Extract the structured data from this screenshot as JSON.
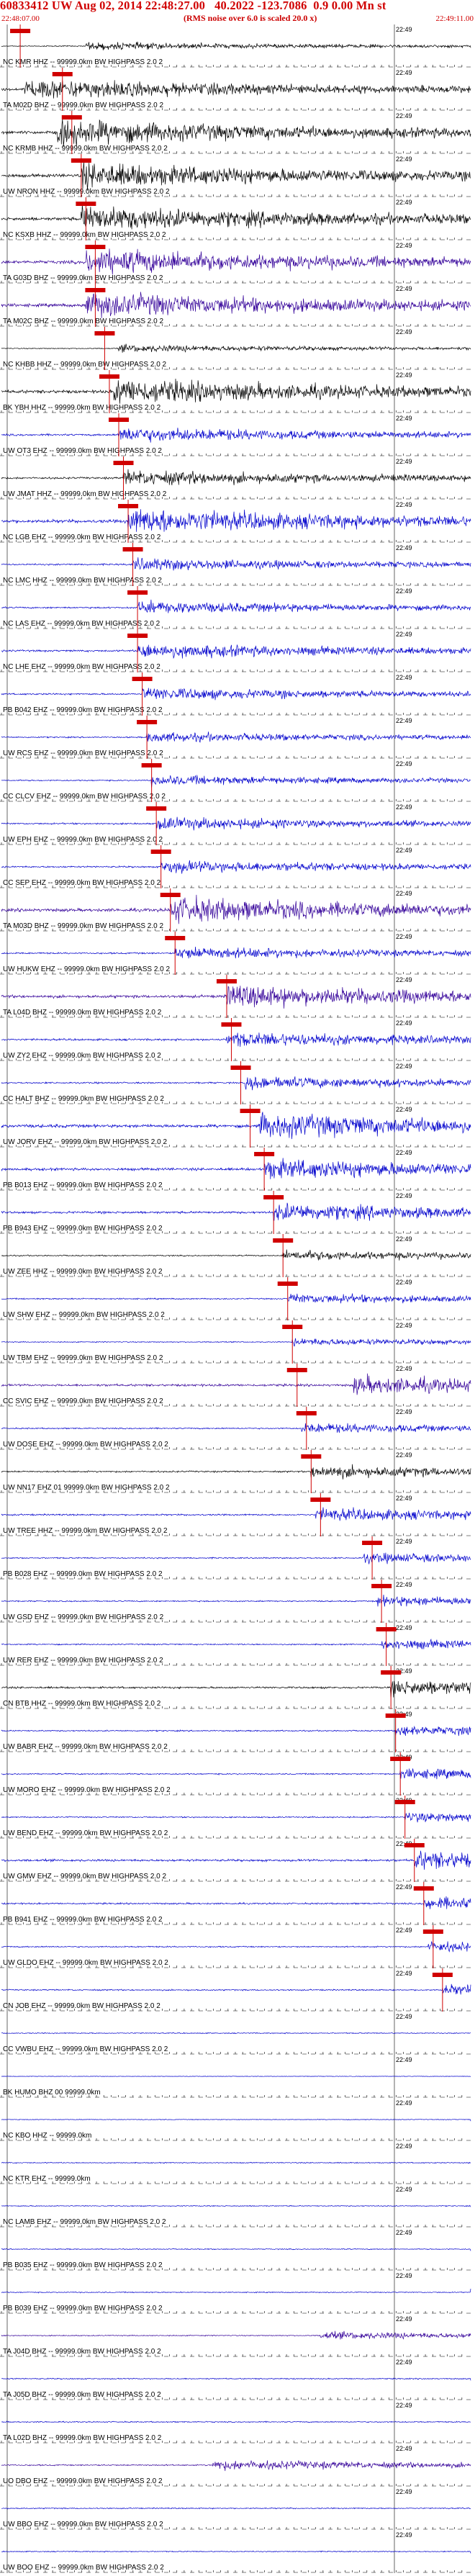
{
  "header": {
    "title": "60833412 UW Aug 02, 2014 22:48:27.00   40.2022 -123.7086  0.9 0.00 Mn st",
    "start_time": "22:48:07.00",
    "end_time": "22:49:11.00",
    "subtitle": "(RMS noise over 6.0 is scaled 20.0 x)"
  },
  "chart_data": {
    "type": "line",
    "title": "60833412 UW Aug 02, 2014 22:48:27.00   40.2022 -123.7086  0.9 0.00 Mn st",
    "time_axis": {
      "start": "22:48:07.00",
      "end": "22:49:11.00",
      "tick_label": "22:49"
    },
    "colors": {
      "background": "#ffffff",
      "pick": "#d00000",
      "black": "#000000",
      "blue": "#0000cc",
      "purple": "#330099"
    },
    "traces": [
      {
        "label": "NC KMR HHZ -- 99999.0km BW HIGHPASS  2.0  2",
        "color": "black",
        "amp": 0.3,
        "onset": 0.18,
        "pick": 0.04
      },
      {
        "label": "TA M02D BHZ -- 99999.0km BW HIGHPASS  2.0  2",
        "color": "black",
        "amp": 0.8,
        "onset": 0.05,
        "pick": 0.13
      },
      {
        "label": "NC KRMB HHZ -- 99999.0km BW HIGHPASS  2.0  2",
        "color": "black",
        "amp": 1.0,
        "onset": 0.12,
        "pick": 0.15
      },
      {
        "label": "UW NRON HHZ -- 99999.0km BW HIGHPASS  2.0  2",
        "color": "black",
        "amp": 1.0,
        "onset": 0.17,
        "pick": 0.17
      },
      {
        "label": "NC KSXB HHZ -- 99999.0km BW HIGHPASS  2.0  2",
        "color": "black",
        "amp": 1.0,
        "onset": 0.17,
        "pick": 0.18
      },
      {
        "label": "TA G03D BHZ -- 99999.0km BW HIGHPASS  2.0  2",
        "color": "purple",
        "amp": 1.0,
        "onset": 0.18,
        "pick": 0.2
      },
      {
        "label": "TA M02C BHZ -- 99999.0km BW HIGHPASS  2.0  2",
        "color": "purple",
        "amp": 1.0,
        "onset": 0.18,
        "pick": 0.2
      },
      {
        "label": "NC KHBB HHZ -- 99999.0km BW HIGHPASS  2.0  2",
        "color": "black",
        "amp": 0.3,
        "onset": 0.25,
        "pick": 0.22
      },
      {
        "label": "BK YBH HHZ -- 99999.0km BW HIGHPASS  2.0  2",
        "color": "black",
        "amp": 1.0,
        "onset": 0.24,
        "pick": 0.23
      },
      {
        "label": "UW OT3 EHZ -- 99999.0km BW HIGHPASS  2.0  2",
        "color": "blue",
        "amp": 0.6,
        "onset": 0.25,
        "pick": 0.25
      },
      {
        "label": "UW JMAT HHZ -- 99999.0km BW HIGHPASS  2.0  2",
        "color": "black",
        "amp": 0.6,
        "onset": 0.26,
        "pick": 0.26
      },
      {
        "label": "NC LGB EHZ -- 99999.0km BW HIGHPASS  2.0  2",
        "color": "blue",
        "amp": 1.0,
        "onset": 0.27,
        "pick": 0.27
      },
      {
        "label": "NC LMC HHZ -- 99999.0km BW HIGHPASS  2.0  2",
        "color": "blue",
        "amp": 0.5,
        "onset": 0.28,
        "pick": 0.28
      },
      {
        "label": "NC LAS EHZ -- 99999.0km BW HIGHPASS  2.0  2",
        "color": "blue",
        "amp": 0.5,
        "onset": 0.29,
        "pick": 0.29
      },
      {
        "label": "NC LHE EHZ -- 99999.0km BW HIGHPASS  2.0  2",
        "color": "blue",
        "amp": 0.6,
        "onset": 0.29,
        "pick": 0.29
      },
      {
        "label": "PB B042 EHZ -- 99999.0km BW HIGHPASS  2.0  2",
        "color": "blue",
        "amp": 0.5,
        "onset": 0.3,
        "pick": 0.3
      },
      {
        "label": "UW RCS EHZ -- 99999.0km BW HIGHPASS  2.0  2",
        "color": "blue",
        "amp": 0.4,
        "onset": 0.31,
        "pick": 0.31
      },
      {
        "label": "CC CLCV EHZ -- 99999.0km BW HIGHPASS  2.0  2",
        "color": "blue",
        "amp": 0.4,
        "onset": 0.32,
        "pick": 0.32
      },
      {
        "label": "UW EPH EHZ -- 99999.0km BW HIGHPASS  2.0  2",
        "color": "blue",
        "amp": 0.5,
        "onset": 0.33,
        "pick": 0.33
      },
      {
        "label": "CC SEP EHZ -- 99999.0km BW HIGHPASS  2.0  2",
        "color": "blue",
        "amp": 0.5,
        "onset": 0.34,
        "pick": 0.34
      },
      {
        "label": "TA M03D BHZ -- 99999.0km BW HIGHPASS  2.0  2",
        "color": "purple",
        "amp": 1.0,
        "onset": 0.36,
        "pick": 0.36
      },
      {
        "label": "UW HUKW EHZ -- 99999.0km BW HIGHPASS  2.0  2",
        "color": "blue",
        "amp": 0.5,
        "onset": 0.37,
        "pick": 0.37
      },
      {
        "label": "TA L04D BHZ -- 99999.0km BW HIGHPASS  2.0  2",
        "color": "purple",
        "amp": 0.9,
        "onset": 0.48,
        "pick": 0.48
      },
      {
        "label": "UW ZY2 EHZ -- 99999.0km BW HIGHPASS  2.0  2",
        "color": "blue",
        "amp": 0.6,
        "onset": 0.48,
        "pick": 0.49
      },
      {
        "label": "CC HALT BHZ -- 99999.0km BW HIGHPASS  2.0  2",
        "color": "blue",
        "amp": 0.5,
        "onset": 0.52,
        "pick": 0.51
      },
      {
        "label": "UW JORV EHZ -- 99999.0km BW HIGHPASS  2.0  2",
        "color": "blue",
        "amp": 1.0,
        "onset": 0.55,
        "pick": 0.53
      },
      {
        "label": "PB B013 EHZ -- 99999.0km BW HIGHPASS  2.0  2",
        "color": "blue",
        "amp": 0.8,
        "onset": 0.56,
        "pick": 0.56
      },
      {
        "label": "PB B943 EHZ -- 99999.0km BW HIGHPASS  2.0  2",
        "color": "blue",
        "amp": 0.7,
        "onset": 0.58,
        "pick": 0.58
      },
      {
        "label": "UW ZEE HHZ -- 99999.0km BW HIGHPASS  2.0  2",
        "color": "black",
        "amp": 0.4,
        "onset": 0.6,
        "pick": 0.6
      },
      {
        "label": "UW SHW EHZ -- 99999.0km BW HIGHPASS  2.0  2",
        "color": "blue",
        "amp": 0.4,
        "onset": 0.61,
        "pick": 0.61
      },
      {
        "label": "UW TBM EHZ -- 99999.0km BW HIGHPASS  2.0  2",
        "color": "blue",
        "amp": 0.3,
        "onset": 0.62,
        "pick": 0.62
      },
      {
        "label": "CC SVIC EHZ -- 99999.0km BW HIGHPASS  2.0  2",
        "color": "purple",
        "amp": 0.7,
        "onset": 0.75,
        "pick": 0.63
      },
      {
        "label": "UW DOSE EHZ -- 99999.0km BW HIGHPASS  2.0  2",
        "color": "blue",
        "amp": 0.4,
        "onset": 0.64,
        "pick": 0.65
      },
      {
        "label": "UW NN17 EHZ 01 99999.0km BW HIGHPASS  2.0  2",
        "color": "black",
        "amp": 0.5,
        "onset": 0.66,
        "pick": 0.66
      },
      {
        "label": "UW TREE HHZ -- 99999.0km BW HIGHPASS  2.0  2",
        "color": "blue",
        "amp": 0.5,
        "onset": 0.67,
        "pick": 0.68
      },
      {
        "label": "PB B028 EHZ -- 99999.0km BW HIGHPASS  2.0  2",
        "color": "blue",
        "amp": 0.4,
        "onset": 0.77,
        "pick": 0.79
      },
      {
        "label": "UW GSD EHZ -- 99999.0km BW HIGHPASS  2.0  2",
        "color": "blue",
        "amp": 0.4,
        "onset": 0.8,
        "pick": 0.81
      },
      {
        "label": "UW RER EHZ -- 99999.0km BW HIGHPASS  2.0  2",
        "color": "blue",
        "amp": 0.4,
        "onset": 0.81,
        "pick": 0.82
      },
      {
        "label": "CN BTB HHZ -- 99999.0km BW HIGHPASS  2.0  2",
        "color": "black",
        "amp": 0.6,
        "onset": 0.83,
        "pick": 0.83
      },
      {
        "label": "UW BABR EHZ -- 99999.0km BW HIGHPASS  2.0  2",
        "color": "blue",
        "amp": 0.4,
        "onset": 0.84,
        "pick": 0.84
      },
      {
        "label": "UW MORO EHZ -- 99999.0km BW HIGHPASS  2.0  2",
        "color": "blue",
        "amp": 0.4,
        "onset": 0.85,
        "pick": 0.85
      },
      {
        "label": "UW BEND EHZ -- 99999.0km BW HIGHPASS  2.0  2",
        "color": "blue",
        "amp": 0.4,
        "onset": 0.86,
        "pick": 0.86
      },
      {
        "label": "UW GMW EHZ -- 99999.0km BW HIGHPASS  2.0  2",
        "color": "blue",
        "amp": 0.7,
        "onset": 0.88,
        "pick": 0.88
      },
      {
        "label": "PB B941 EHZ -- 99999.0km BW HIGHPASS  2.0  2",
        "color": "blue",
        "amp": 0.5,
        "onset": 0.9,
        "pick": 0.9
      },
      {
        "label": "UW GLDO EHZ -- 99999.0km BW HIGHPASS  2.0  2",
        "color": "blue",
        "amp": 0.4,
        "onset": 0.91,
        "pick": 0.92
      },
      {
        "label": "CN JOB EHZ -- 99999.0km BW HIGHPASS  2.0  2",
        "color": "blue",
        "amp": 0.4,
        "onset": 0.94,
        "pick": 0.94
      },
      {
        "label": "CC VWBU EHZ -- 99999.0km BW HIGHPASS  2.0  2",
        "color": "blue",
        "amp": 0.3,
        "onset": 1.0
      },
      {
        "label": "BK HUMO BHZ 00 99999.0km",
        "color": "blue",
        "amp": 0.15,
        "onset": 1.0
      },
      {
        "label": "NC KBO HHZ -- 99999.0km",
        "color": "blue",
        "amp": 0.2,
        "onset": 1.0
      },
      {
        "label": "NC KTR EHZ -- 99999.0km",
        "color": "blue",
        "amp": 0.3,
        "onset": 1.0
      },
      {
        "label": "NC LAMB EHZ -- 99999.0km BW HIGHPASS  2.0  2",
        "color": "blue",
        "amp": 0.3,
        "onset": 1.0
      },
      {
        "label": "PB B035 EHZ -- 99999.0km BW HIGHPASS  2.0  2",
        "color": "blue",
        "amp": 0.3,
        "onset": 1.0
      },
      {
        "label": "PB B039 EHZ -- 99999.0km BW HIGHPASS  2.0  2",
        "color": "blue",
        "amp": 0.3,
        "onset": 1.0
      },
      {
        "label": "TA J04D BHZ -- 99999.0km BW HIGHPASS  2.0  2",
        "color": "purple",
        "amp": 0.3,
        "onset": 0.68
      },
      {
        "label": "TA J05D BHZ -- 99999.0km BW HIGHPASS  2.0  2",
        "color": "blue",
        "amp": 0.35,
        "onset": 1.0
      },
      {
        "label": "TA L02D BHZ -- 99999.0km BW HIGHPASS  2.0  2",
        "color": "blue",
        "amp": 0.35,
        "onset": 1.0
      },
      {
        "label": "UO DBO EHZ -- 99999.0km BW HIGHPASS  2.0  2",
        "color": "purple",
        "amp": 0.4,
        "onset": 0.45
      },
      {
        "label": "UW BBO EHZ -- 99999.0km BW HIGHPASS  2.0  2",
        "color": "blue",
        "amp": 0.35,
        "onset": 1.0
      },
      {
        "label": "UW BOO EHZ -- 99999.0km BW HIGHPASS  2.0  2",
        "color": "blue",
        "amp": 0.3,
        "onset": 1.0
      }
    ]
  }
}
